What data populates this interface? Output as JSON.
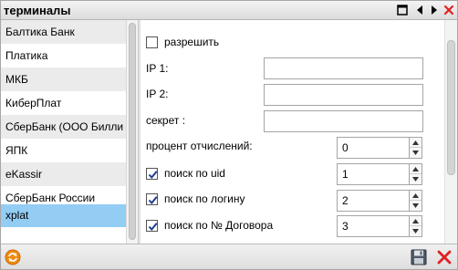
{
  "window": {
    "title": "терминалы"
  },
  "terminals": [
    {
      "label": "Балтика Банк"
    },
    {
      "label": "Платика"
    },
    {
      "label": "МКБ"
    },
    {
      "label": "КиберПлат"
    },
    {
      "label": "СберБанк (ООО Билли"
    },
    {
      "label": "ЯПК"
    },
    {
      "label": "eKassir"
    },
    {
      "label": "СберБанк России"
    },
    {
      "label": "xplat"
    }
  ],
  "selected_terminal": "xplat",
  "form": {
    "allow_label": "разрешить",
    "allow_checked": false,
    "ip1_label": "IP 1:",
    "ip1_value": "",
    "ip2_label": "IP 2:",
    "ip2_value": "",
    "secret_label": "секрет :",
    "secret_value": "",
    "percent_label": "процент отчислений:",
    "percent_value": "0",
    "search_uid_label": "поиск по uid",
    "search_uid_checked": true,
    "search_uid_value": "1",
    "search_login_label": "поиск по логину",
    "search_login_checked": true,
    "search_login_value": "2",
    "search_contract_label": "поиск по № Договора",
    "search_contract_checked": true,
    "search_contract_value": "3"
  },
  "colors": {
    "selection": "#93cdf4",
    "close_red": "#e02020",
    "refresh_orange": "#f08a10"
  },
  "icons": {
    "maximize": "maximize-icon",
    "prev": "chevron-left-icon",
    "next": "chevron-right-icon",
    "close": "close-icon",
    "refresh": "refresh-icon",
    "save": "save-icon",
    "cancel": "cancel-icon"
  }
}
